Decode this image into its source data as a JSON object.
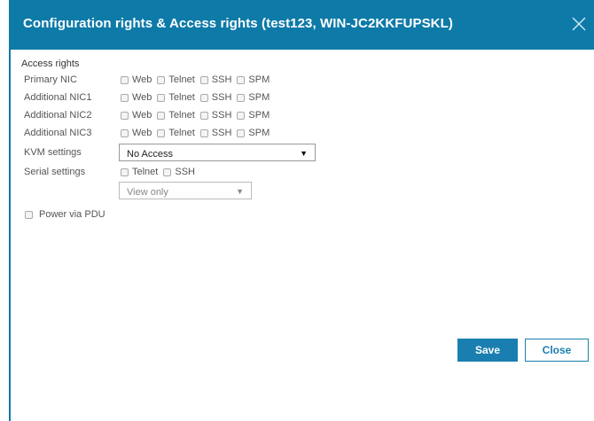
{
  "dialog": {
    "title": "Configuration rights & Access rights (test123, WIN-JC2KKFUPSKL)",
    "close_icon": "close-icon"
  },
  "access": {
    "section_title": "Access rights",
    "nic_rows": [
      {
        "label": "Primary NIC",
        "options": [
          "Web",
          "Telnet",
          "SSH",
          "SPM"
        ]
      },
      {
        "label": "Additional NIC1",
        "options": [
          "Web",
          "Telnet",
          "SSH",
          "SPM"
        ]
      },
      {
        "label": "Additional NIC2",
        "options": [
          "Web",
          "Telnet",
          "SSH",
          "SPM"
        ]
      },
      {
        "label": "Additional NIC3",
        "options": [
          "Web",
          "Telnet",
          "SSH",
          "SPM"
        ]
      }
    ],
    "kvm": {
      "label": "KVM settings",
      "value": "No Access"
    },
    "serial": {
      "label": "Serial settings",
      "options": [
        "Telnet",
        "SSH"
      ],
      "mode_value": "View only"
    },
    "power_label": "Power via PDU"
  },
  "buttons": {
    "save": "Save",
    "close": "Close"
  },
  "colors": {
    "accent": "#0e7aa8",
    "button": "#1a7fb0"
  }
}
